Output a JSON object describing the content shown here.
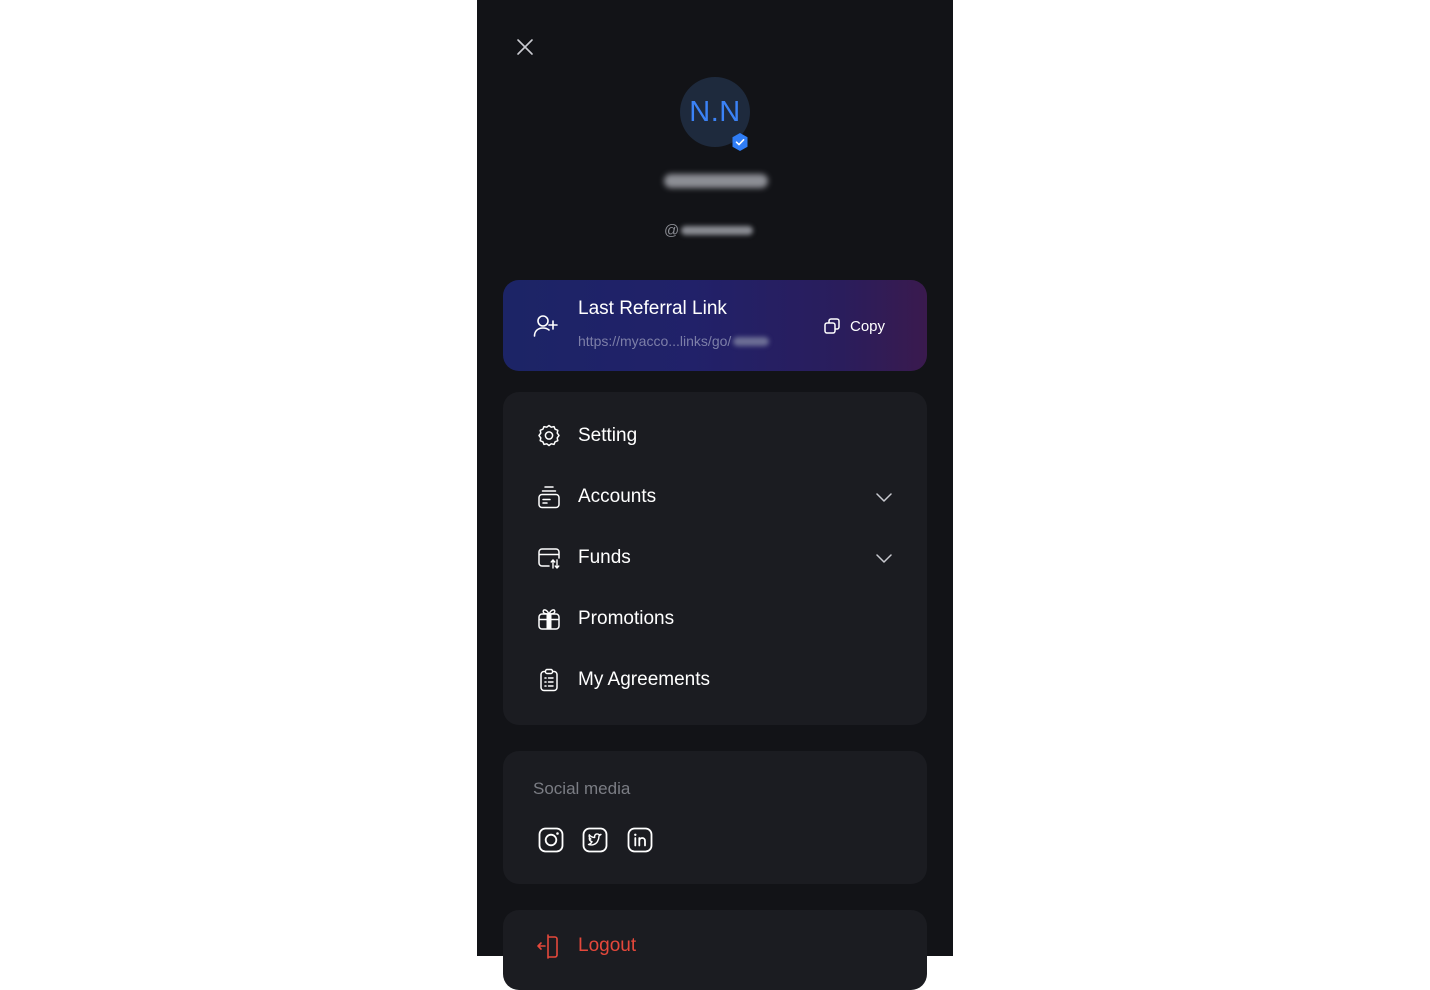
{
  "profile": {
    "initials": "N.N",
    "handle_prefix": "@"
  },
  "referral": {
    "title": "Last Referral Link",
    "link": "https://myacco...links/go/",
    "copy_label": "Copy"
  },
  "menu": {
    "items": [
      {
        "label": "Setting",
        "icon": "gear-icon",
        "expandable": false
      },
      {
        "label": "Accounts",
        "icon": "accounts-stack-icon",
        "expandable": true
      },
      {
        "label": "Funds",
        "icon": "card-transfer-icon",
        "expandable": true
      },
      {
        "label": "Promotions",
        "icon": "gift-icon",
        "expandable": false
      },
      {
        "label": "My Agreements",
        "icon": "clipboard-icon",
        "expandable": false
      }
    ]
  },
  "social": {
    "title": "Social media",
    "networks": [
      "instagram-icon",
      "twitter-icon",
      "linkedin-icon"
    ]
  },
  "logout": {
    "label": "Logout"
  },
  "colors": {
    "panel_bg": "#121317",
    "card_bg": "#1b1c21",
    "accent_blue": "#3b82f6",
    "logout_red": "#e5483b"
  }
}
